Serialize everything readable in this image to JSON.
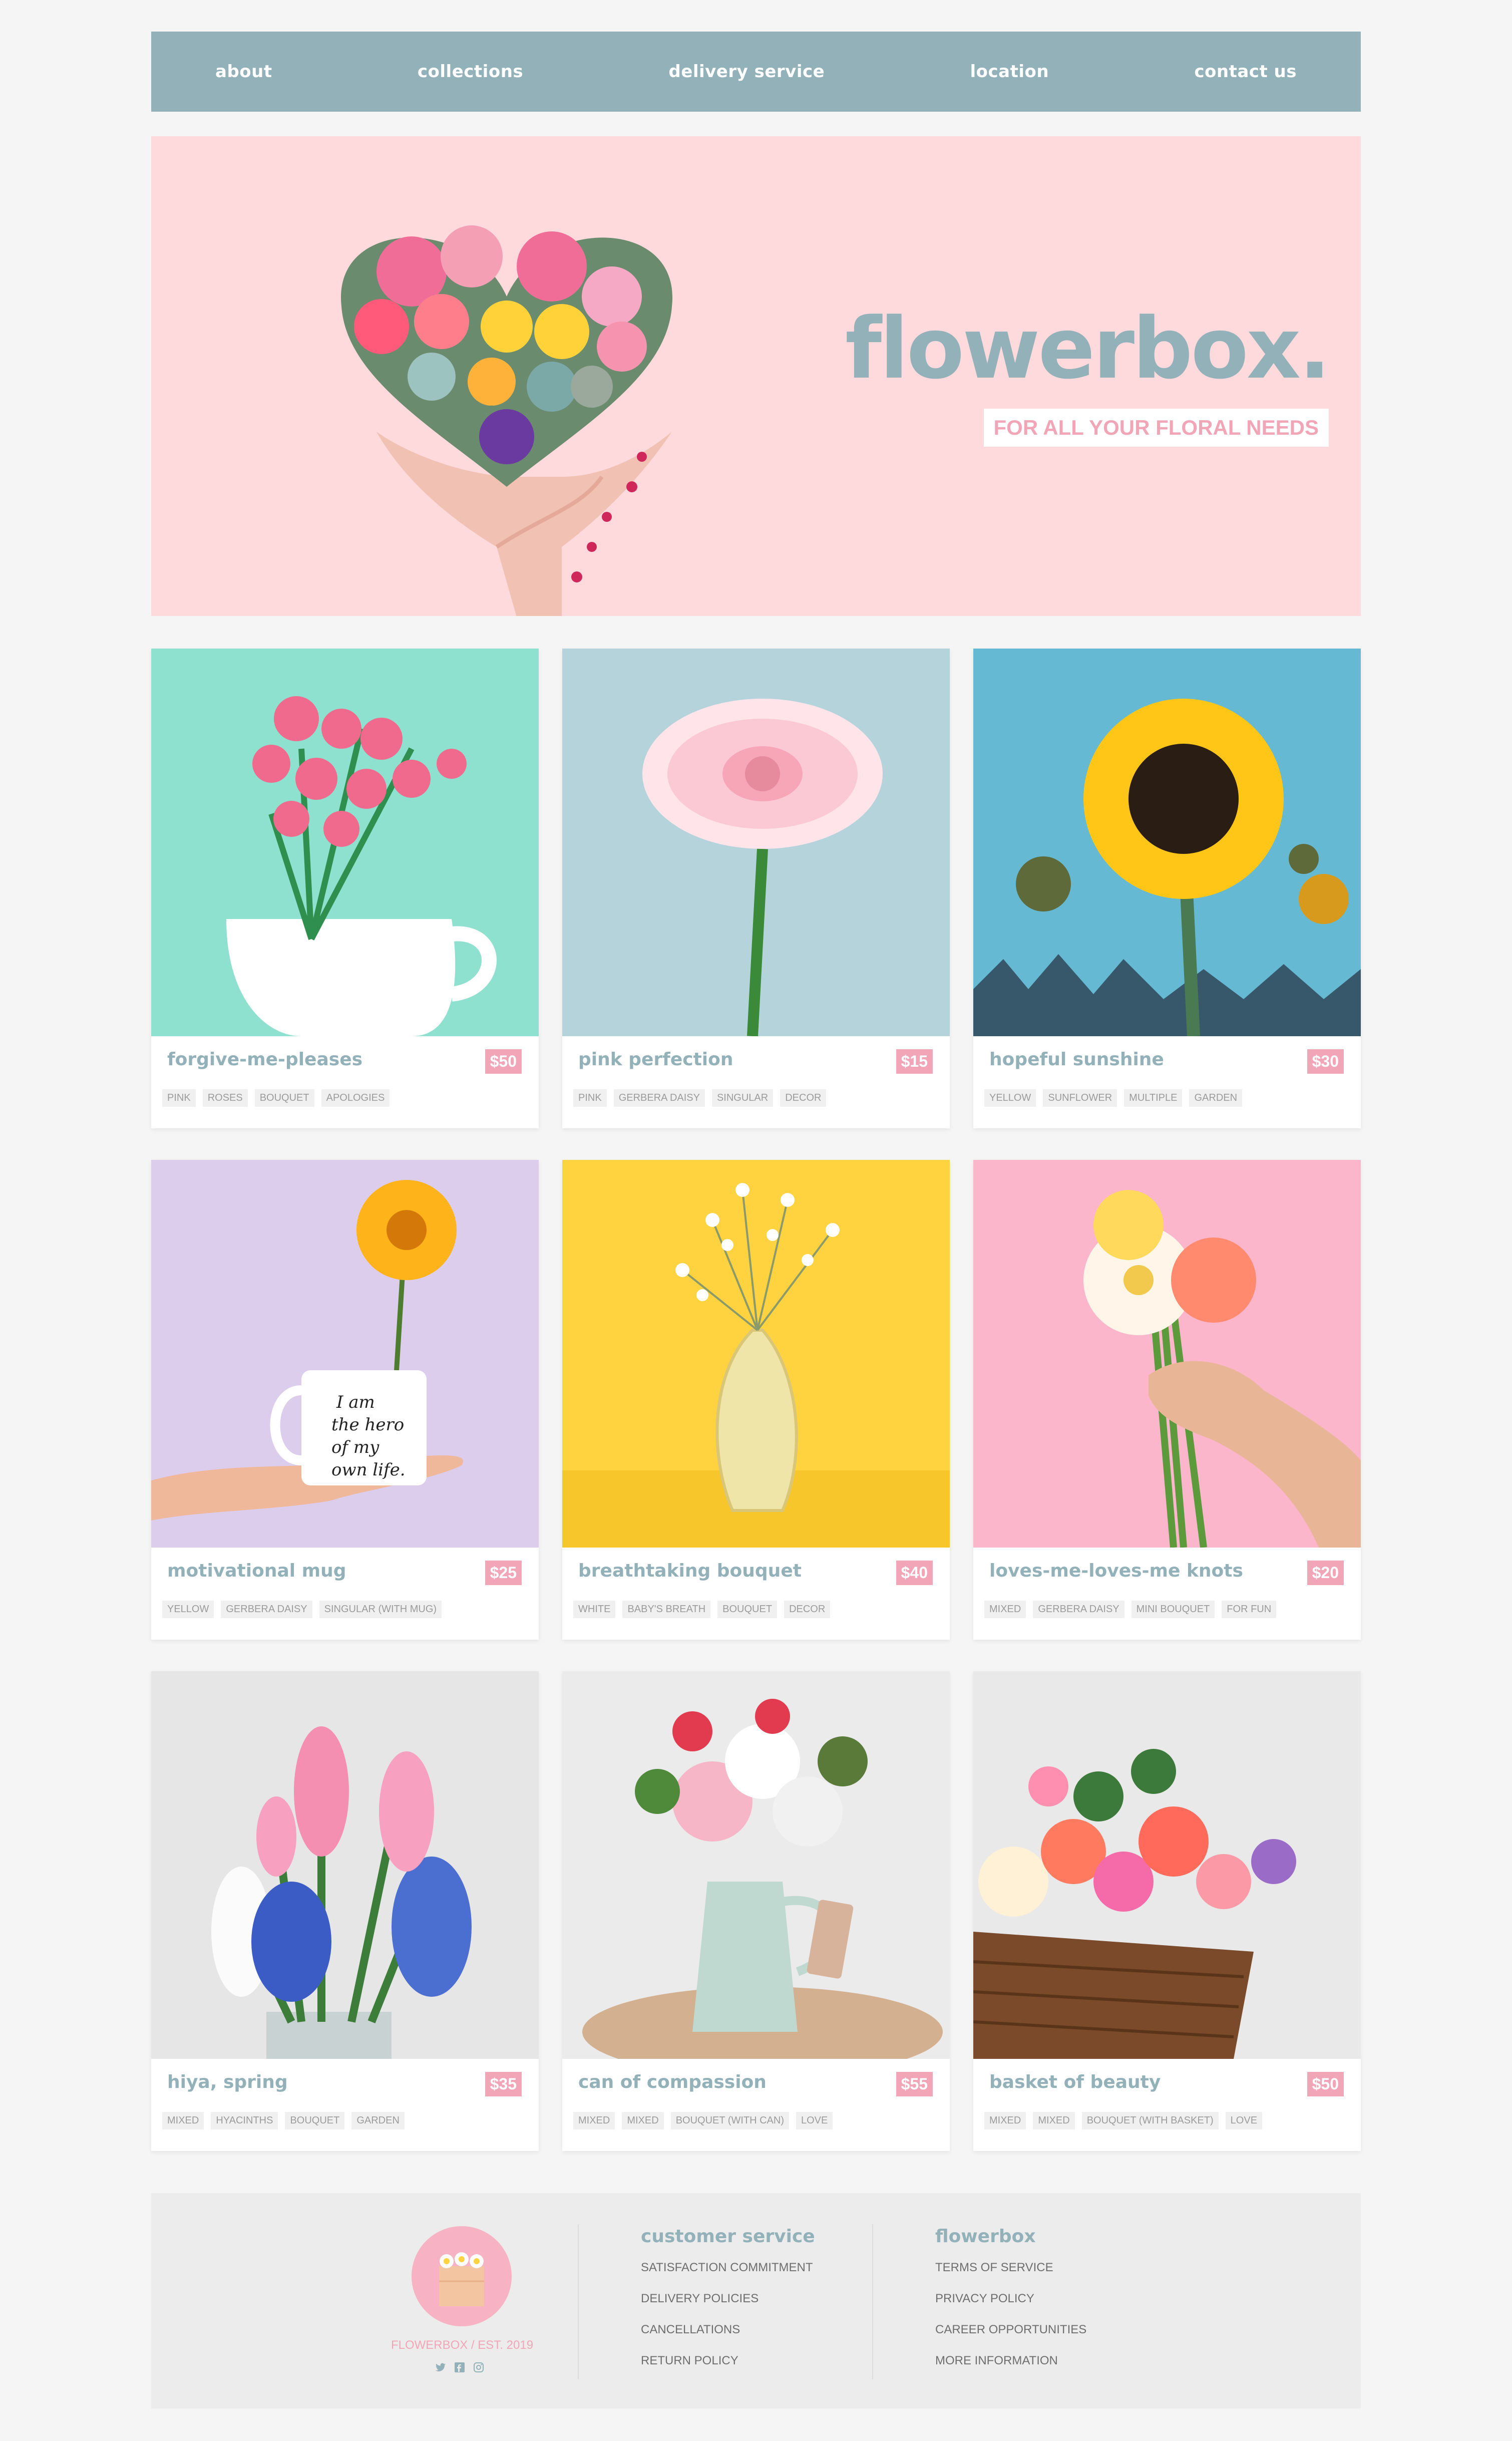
{
  "nav": {
    "items": [
      "about",
      "collections",
      "delivery service",
      "location",
      "contact us"
    ]
  },
  "hero": {
    "title": "flowerbox.",
    "tagline": "FOR ALL YOUR FLORAL NEEDS"
  },
  "products": [
    {
      "name": "forgive-me-pleases",
      "price": "$50",
      "tags": [
        "PINK",
        "ROSES",
        "BOUQUET",
        "APOLOGIES"
      ]
    },
    {
      "name": "pink perfection",
      "price": "$15",
      "tags": [
        "PINK",
        "GERBERA DAISY",
        "SINGULAR",
        "DECOR"
      ]
    },
    {
      "name": "hopeful sunshine",
      "price": "$30",
      "tags": [
        "YELLOW",
        "SUNFLOWER",
        "MULTIPLE",
        "GARDEN"
      ]
    },
    {
      "name": "motivational mug",
      "price": "$25",
      "tags": [
        "YELLOW",
        "GERBERA DAISY",
        "SINGULAR (WITH MUG)"
      ]
    },
    {
      "name": "breathtaking bouquet",
      "price": "$40",
      "tags": [
        "WHITE",
        "BABY'S BREATH",
        "BOUQUET",
        "DECOR"
      ]
    },
    {
      "name": "loves-me-loves-me knots",
      "price": "$20",
      "tags": [
        "MIXED",
        "GERBERA DAISY",
        "MINI BOUQUET",
        "FOR FUN"
      ]
    },
    {
      "name": "hiya, spring",
      "price": "$35",
      "tags": [
        "MIXED",
        "HYACINTHS",
        "BOUQUET",
        "GARDEN"
      ]
    },
    {
      "name": "can of compassion",
      "price": "$55",
      "tags": [
        "MIXED",
        "MIXED",
        "BOUQUET (WITH CAN)",
        "LOVE"
      ]
    },
    {
      "name": "basket of beauty",
      "price": "$50",
      "tags": [
        "MIXED",
        "MIXED",
        "BOUQUET (WITH BASKET)",
        "LOVE"
      ]
    }
  ],
  "mug_text": [
    "I am",
    "the hero",
    "of my",
    "own life."
  ],
  "footer": {
    "logo_text": "FLOWERBOX / EST. 2019",
    "social": [
      "twitter-icon",
      "facebook-icon",
      "instagram-icon"
    ],
    "customer_service": {
      "heading": "customer service",
      "links": [
        "SATISFACTION COMMITMENT",
        "DELIVERY POLICIES",
        "CANCELLATIONS",
        "RETURN POLICY"
      ]
    },
    "flowerbox": {
      "heading": "flowerbox",
      "links": [
        "TERMS OF SERVICE",
        "PRIVACY POLICY",
        "CAREER OPPORTUNITIES",
        "MORE INFORMATION"
      ]
    }
  },
  "colors": {
    "accent_teal": "#92b1b9",
    "accent_pink": "#f2a5b6",
    "hero_bg": "#fedadd",
    "page_bg": "#f5f5f5"
  }
}
